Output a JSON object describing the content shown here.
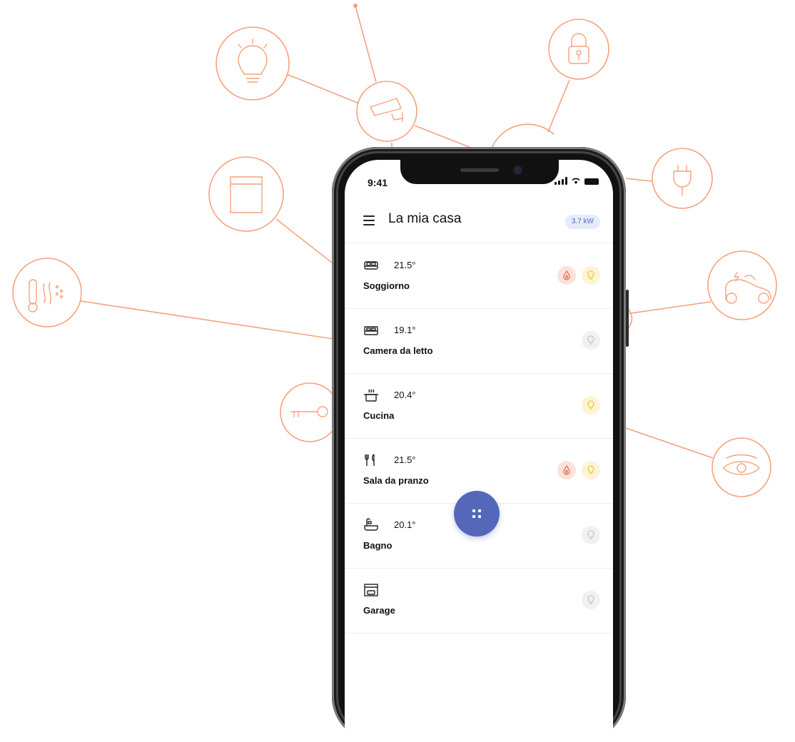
{
  "colors": {
    "accent": "#5567b9",
    "deco": "#f4a27e",
    "flame": "#e36f4d",
    "bulb_on": "#f2c73a",
    "bulb_off": "#c8c8c8"
  },
  "status_bar": {
    "time": "9:41"
  },
  "header": {
    "title": "La mia casa",
    "power": "3.7 kW",
    "menu_icon": "menu-icon"
  },
  "rooms": [
    {
      "name": "Soggiorno",
      "temp": "21.5°",
      "icon": "sofa-icon",
      "heating": true,
      "light": "on"
    },
    {
      "name": "Camera da letto",
      "temp": "19.1°",
      "icon": "bed-icon",
      "heating": false,
      "light": "off"
    },
    {
      "name": "Cucina",
      "temp": "20.4°",
      "icon": "pot-icon",
      "heating": false,
      "light": "on"
    },
    {
      "name": "Sala da pranzo",
      "temp": "21.5°",
      "icon": "cutlery-icon",
      "heating": true,
      "light": "on"
    },
    {
      "name": "Bagno",
      "temp": "20.1°",
      "icon": "bathtub-icon",
      "heating": false,
      "light": "off"
    },
    {
      "name": "Garage",
      "temp": "",
      "icon": "garage-icon",
      "heating": false,
      "light": "off"
    }
  ],
  "decorative_icons": [
    "lightbulb-icon",
    "security-camera-icon",
    "lock-icon",
    "plug-icon",
    "electric-car-icon",
    "eye-icon",
    "key-icon",
    "thermometer-icon",
    "dishwasher-icon"
  ],
  "fab": {
    "icon": "grid-dots-icon"
  }
}
